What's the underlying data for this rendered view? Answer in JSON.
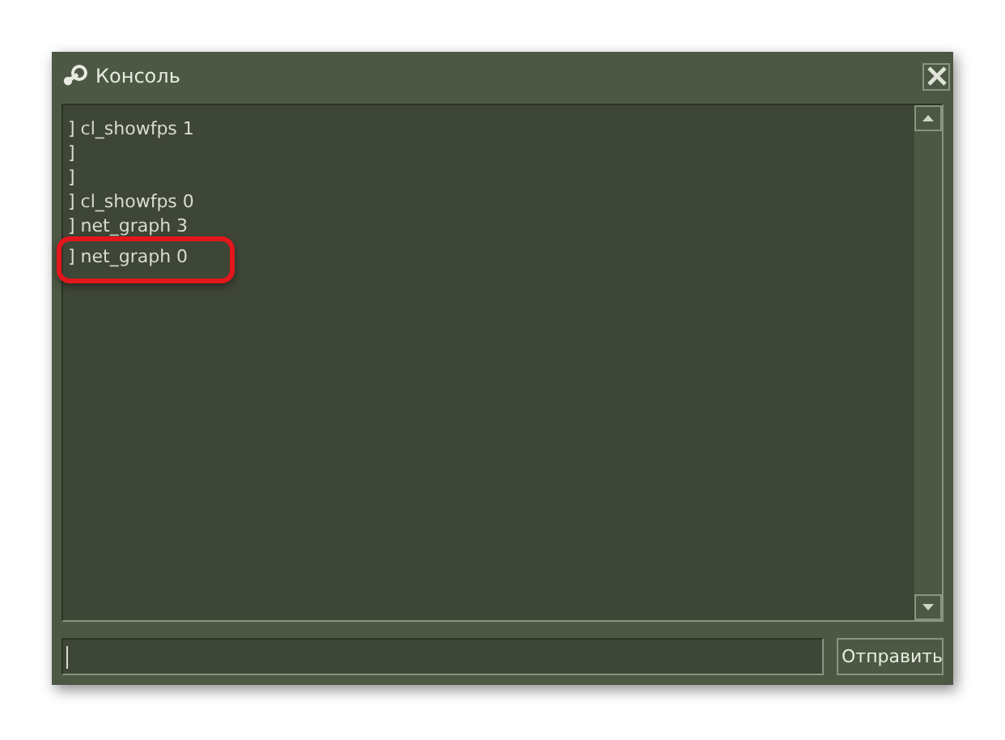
{
  "window": {
    "title": "Консоль"
  },
  "log": {
    "lines": [
      {
        "text": "] cl_showfps 1",
        "highlighted": false
      },
      {
        "text": "]",
        "highlighted": false
      },
      {
        "text": "]",
        "highlighted": false
      },
      {
        "text": "] cl_showfps 0",
        "highlighted": false
      },
      {
        "text": "] net_graph 3",
        "highlighted": false
      },
      {
        "text": "] net_graph 0",
        "highlighted": true
      }
    ]
  },
  "buttons": [
    "Отправить"
  ]
}
